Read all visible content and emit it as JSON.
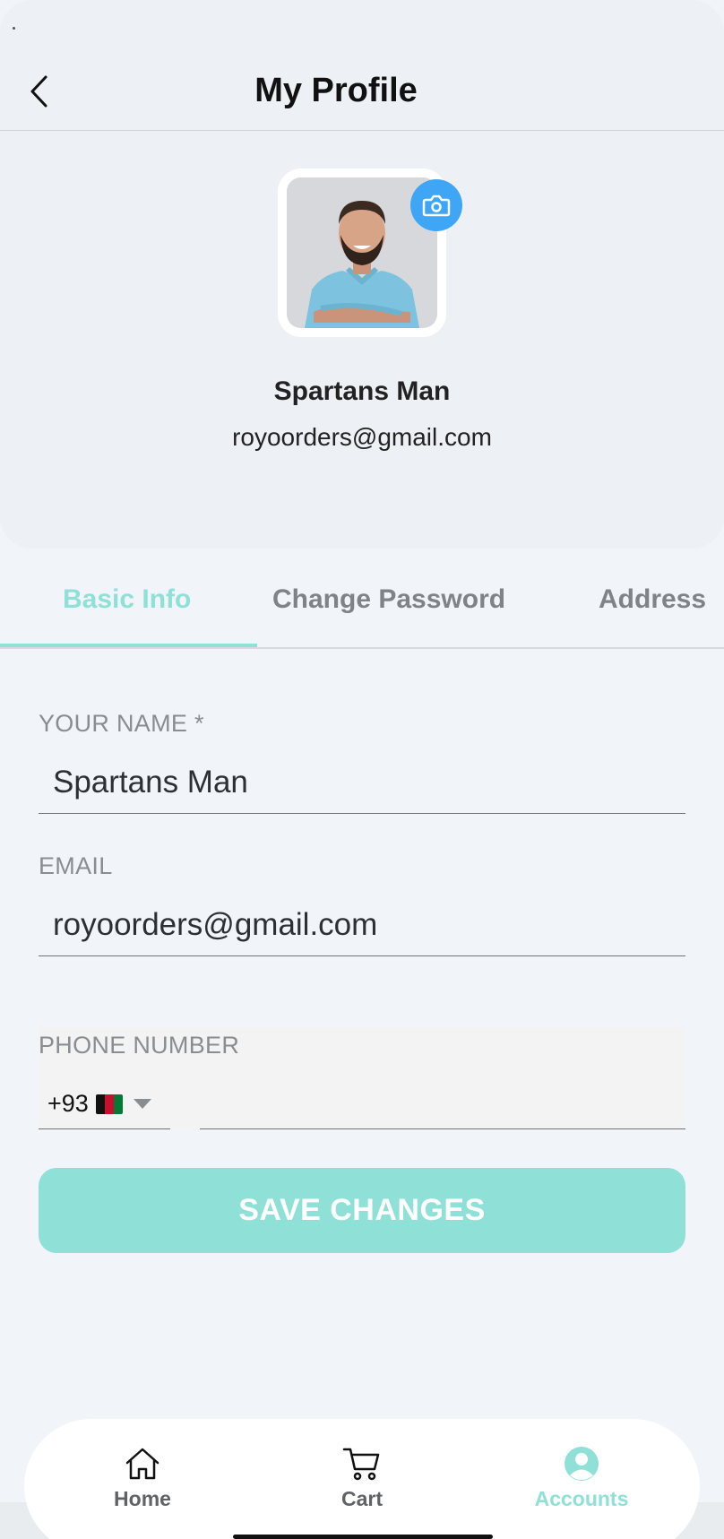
{
  "header": {
    "title": "My Profile"
  },
  "profile": {
    "name": "Spartans Man",
    "email": "royoorders@gmail.com"
  },
  "tabs": [
    {
      "label": "Basic Info",
      "active": true
    },
    {
      "label": "Change Password",
      "active": false
    },
    {
      "label": "Address",
      "active": false
    }
  ],
  "form": {
    "name_label": "YOUR NAME *",
    "name_value": "Spartans Man",
    "email_label": "EMAIL",
    "email_value": "royoorders@gmail.com",
    "phone_label": "PHONE NUMBER",
    "country_code": "+93",
    "phone_value": "",
    "save_label": "SAVE CHANGES"
  },
  "nav": [
    {
      "label": "Home",
      "icon": "home-icon",
      "active": false
    },
    {
      "label": "Cart",
      "icon": "cart-icon",
      "active": false
    },
    {
      "label": "Accounts",
      "icon": "account-icon",
      "active": true
    }
  ],
  "colors": {
    "accent": "#8fe0d6",
    "camera": "#3ea6f4"
  }
}
